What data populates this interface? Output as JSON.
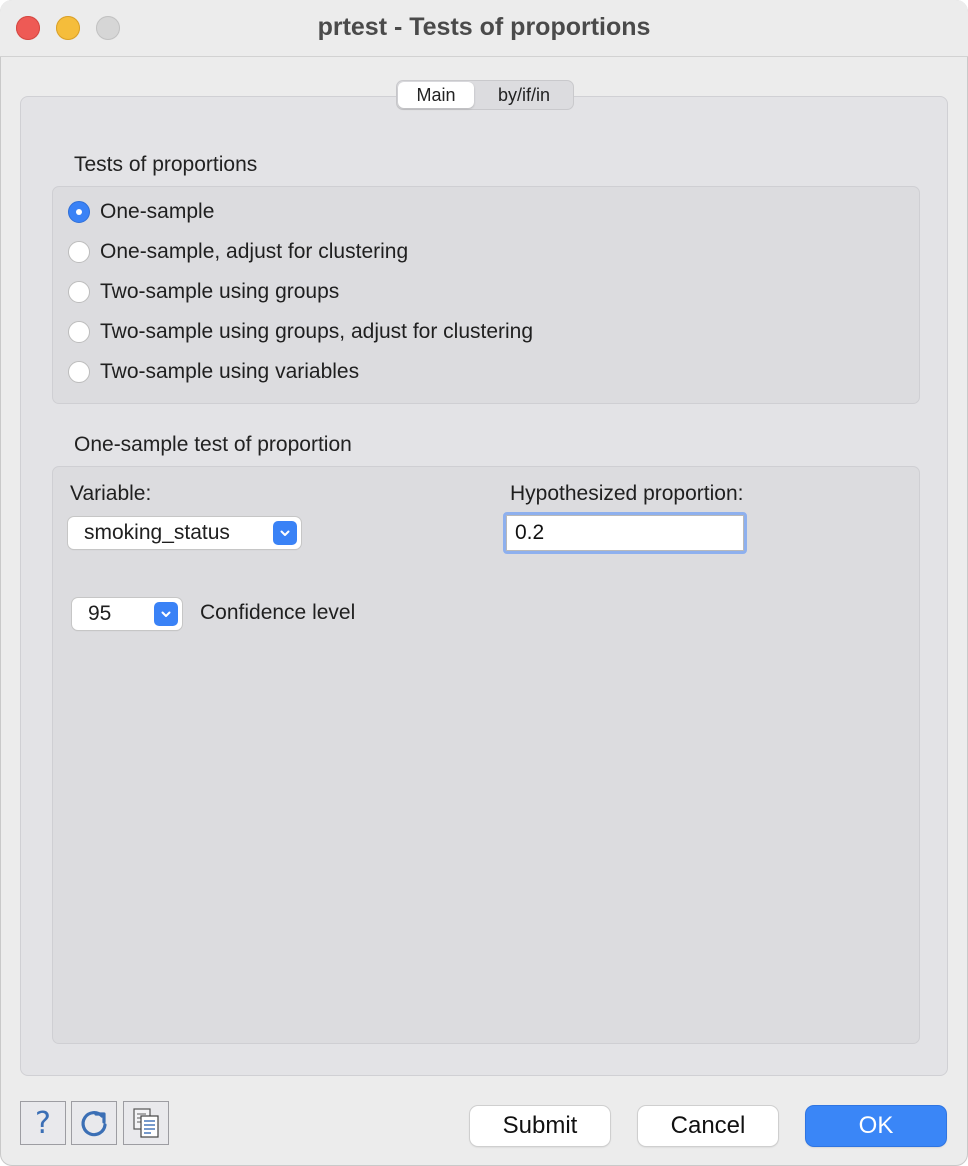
{
  "window": {
    "title": "prtest - Tests of proportions"
  },
  "tabs": [
    {
      "label": "Main",
      "selected": true
    },
    {
      "label": "by/if/in",
      "selected": false
    }
  ],
  "tests_group": {
    "label": "Tests of proportions",
    "options": [
      {
        "label": "One-sample",
        "selected": true
      },
      {
        "label": "One-sample, adjust for clustering",
        "selected": false
      },
      {
        "label": "Two-sample using groups",
        "selected": false
      },
      {
        "label": "Two-sample using groups, adjust for clustering",
        "selected": false
      },
      {
        "label": "Two-sample using variables",
        "selected": false
      }
    ]
  },
  "one_sample_group": {
    "label": "One-sample test of proportion",
    "variable_label": "Variable:",
    "variable_value": "smoking_status",
    "hypothesized_label": "Hypothesized proportion:",
    "hypothesized_value": "0.2",
    "confidence_value": "95",
    "confidence_label": "Confidence level"
  },
  "toolbar": {
    "help_icon": "question-mark-icon",
    "reset_icon": "refresh-icon",
    "copy_icon": "copy-command-icon"
  },
  "buttons": {
    "submit": "Submit",
    "cancel": "Cancel",
    "ok": "OK"
  },
  "colors": {
    "accent": "#3a86f7",
    "close": "#ee5a55",
    "minimize": "#f5bd3b"
  }
}
